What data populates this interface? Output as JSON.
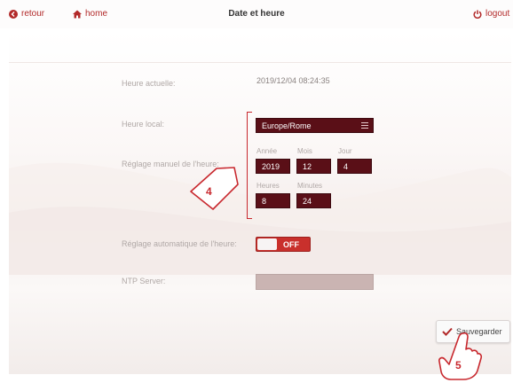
{
  "header": {
    "back_label": "retour",
    "home_label": "home",
    "title": "Date et heure",
    "logout_label": "logout"
  },
  "form": {
    "current_time_label": "Heure actuelle:",
    "current_time_value": "2019/12/04 08:24:35",
    "local_time_label": "Heure local:",
    "timezone_value": "Europe/Rome",
    "manual_time_label": "Réglage manuel de l'heure:",
    "year_label": "Année",
    "year_value": "2019",
    "month_label": "Mois",
    "month_value": "12",
    "day_label": "Jour",
    "day_value": "4",
    "hours_label": "Heures",
    "hours_value": "8",
    "minutes_label": "Minutes",
    "minutes_value": "24",
    "auto_time_label": "Réglage automatique de l'heure:",
    "auto_time_toggle": "OFF",
    "ntp_label": "NTP Server:",
    "ntp_value": ""
  },
  "actions": {
    "save_label": "Sauvegarder"
  },
  "callouts": {
    "step4": "4",
    "step5": "5"
  },
  "colors": {
    "accent": "#b22a2a",
    "field_bg": "#5a0f17",
    "toggle_bg": "#c9302c",
    "callout": "#c8282e"
  },
  "icons": {
    "back": "circle-arrow-left-icon",
    "home": "house-icon",
    "logout": "power-icon",
    "menu": "hamburger-menu-icon",
    "save": "checkmark-icon",
    "pointer": "hand-pointer-icon"
  }
}
